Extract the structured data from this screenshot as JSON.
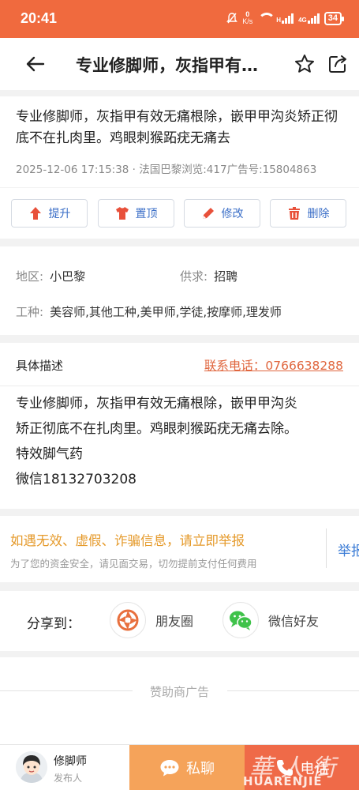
{
  "status_bar": {
    "time": "20:41",
    "net_speed_value": "0",
    "net_speed_unit": "K/s",
    "signal_1": "H",
    "signal_2": "4G",
    "battery": "34"
  },
  "navbar": {
    "title": "专业修脚师，灰指甲有效无痛根除，嵌甲甲沟炎矫正彻底不在扎肉里。鸡眼刺猴跖疣无痛去",
    "back_icon": "back-arrow-icon",
    "favorite_icon": "star-icon",
    "share_icon": "share-icon"
  },
  "post": {
    "title": "专业修脚师，灰指甲有效无痛根除，嵌甲甲沟炎矫正彻底不在扎肉里。鸡眼刺猴跖疣无痛去",
    "meta": "2025-12-06 17:15:38 · 法国巴黎浏览:417广告号:15804863"
  },
  "actions": [
    {
      "label": "提升",
      "icon": "arrow-up-icon"
    },
    {
      "label": "置顶",
      "icon": "shirt-icon"
    },
    {
      "label": "修改",
      "icon": "pencil-icon"
    },
    {
      "label": "删除",
      "icon": "trash-icon"
    }
  ],
  "info": {
    "region_label": "地区:",
    "region_value": "小巴黎",
    "supply_label": "供求:",
    "supply_value": "招聘",
    "job_label": "工种:",
    "job_value": "美容师,其他工种,美甲师,学徒,按摩师,理发师"
  },
  "description": {
    "heading": "具体描述",
    "phone": "联系电话：0766638288",
    "lines": [
      "专业修脚师，灰指甲有效无痛根除，嵌甲甲沟炎",
      "矫正彻底不在扎肉里。鸡眼刺猴跖疣无痛去除。",
      "特效脚气药",
      "微信18132703208"
    ]
  },
  "warning": {
    "title": "如遇无效、虚假、诈骗信息，请立即举报",
    "subtitle": "为了您的资金安全，请见面交易，切勿提前支付任何费用",
    "report": "举报"
  },
  "share": {
    "label": "分享到：",
    "moments": "朋友圈",
    "wechat": "微信好友"
  },
  "sponsor": {
    "label": "赞助商广告"
  },
  "bottom_bar": {
    "poster_name": "修脚师",
    "poster_role": "发布人",
    "chat_label": "私聊",
    "call_label": "电话",
    "watermark": "HUARENJIE"
  },
  "colors": {
    "brand": "#f06a3e",
    "chat": "#f5a35a",
    "call": "#ef6a48",
    "link": "#3a6ec7",
    "warning": "#e59a2b",
    "report": "#3a7bd5",
    "wechat_green": "#3fc24a",
    "delete_red": "#e8503a"
  }
}
